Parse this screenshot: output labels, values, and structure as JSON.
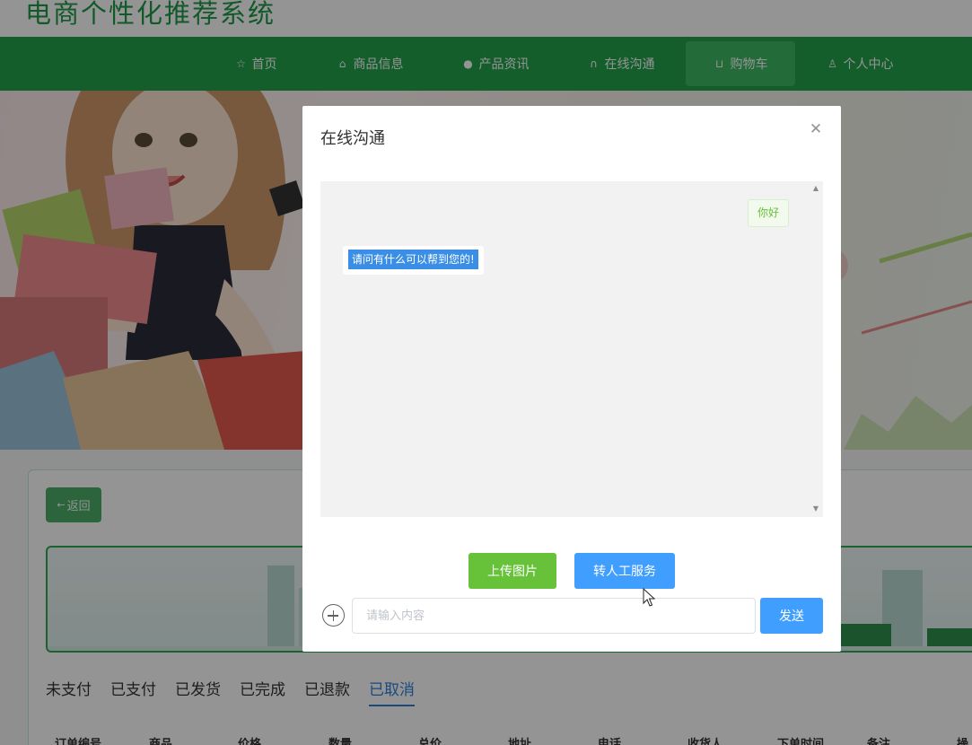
{
  "site": {
    "title": "电商个性化推荐系统"
  },
  "nav": {
    "items": [
      {
        "label": "首页",
        "icon": "star-icon"
      },
      {
        "label": "商品信息",
        "icon": "bag-icon"
      },
      {
        "label": "产品资讯",
        "icon": "info-icon"
      },
      {
        "label": "在线沟通",
        "icon": "headset-icon"
      },
      {
        "label": "购物车",
        "icon": "cart-icon",
        "active": true
      },
      {
        "label": "个人中心",
        "icon": "user-icon"
      }
    ]
  },
  "orders": {
    "back_label": "返回",
    "tabs": [
      {
        "label": "未支付"
      },
      {
        "label": "已支付"
      },
      {
        "label": "已发货"
      },
      {
        "label": "已完成"
      },
      {
        "label": "已退款"
      },
      {
        "label": "已取消",
        "active": true
      }
    ],
    "columns": [
      "订单编号",
      "商品",
      "价格",
      "数量",
      "总价",
      "地址",
      "电话",
      "收货人",
      "下单时间",
      "备注",
      "操"
    ]
  },
  "dialog": {
    "title": "在线沟通",
    "messages": [
      {
        "side": "right",
        "text": "你好"
      },
      {
        "side": "left",
        "text": "请问有什么可以帮到您的!"
      }
    ],
    "upload_label": "上传图片",
    "human_label": "转人工服务",
    "input": {
      "placeholder": "请输入内容",
      "value": ""
    },
    "send_label": "发送"
  },
  "colors": {
    "brand_green": "#23a24d",
    "primary_blue": "#409eff",
    "success_green": "#67c23a"
  }
}
